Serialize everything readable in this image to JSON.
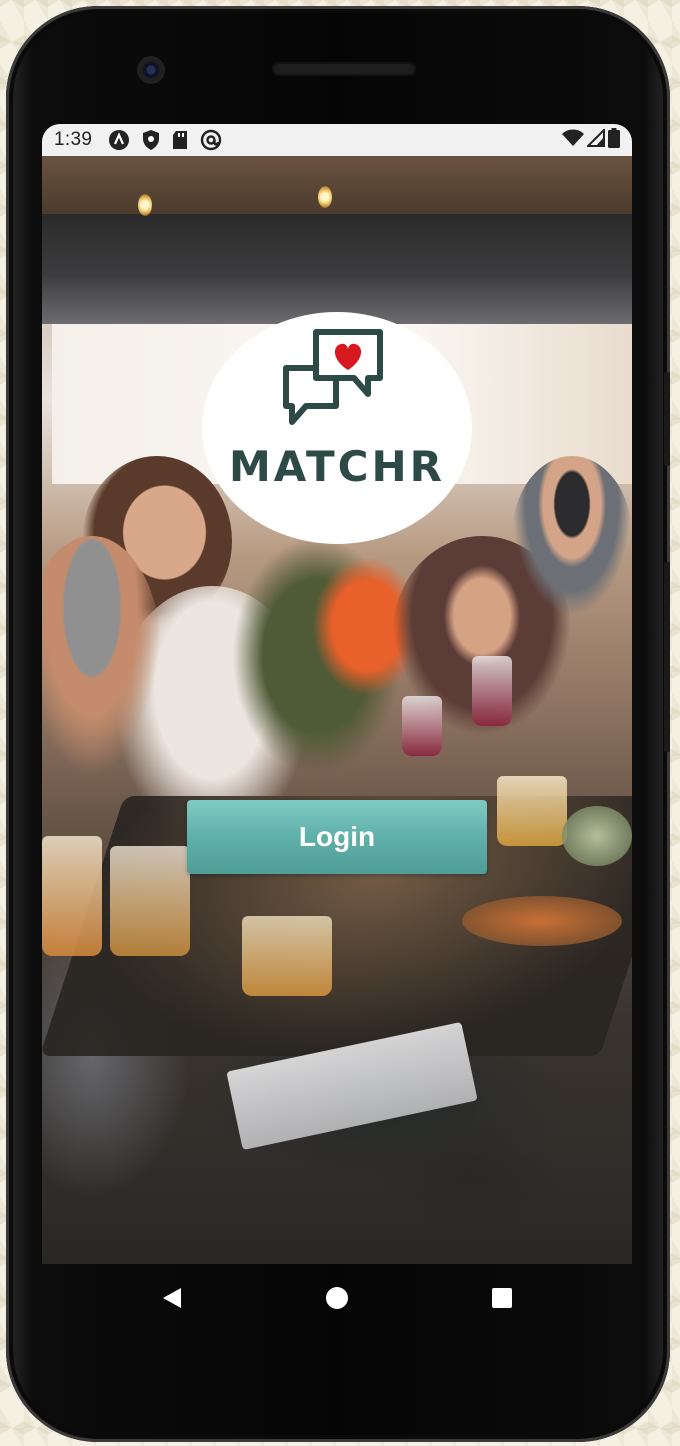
{
  "status_bar": {
    "time": "1:39",
    "left_icons": [
      "assistant-icon",
      "shield-icon",
      "sd-card-icon",
      "at-sign-icon"
    ],
    "right_icons": [
      "wifi-icon",
      "signal-icon",
      "battery-icon"
    ]
  },
  "logo": {
    "icon": "chat-bubbles-heart-icon",
    "text": "MATCHR",
    "text_color": "#2e4a46",
    "heart_color": "#d7191f"
  },
  "login_button": {
    "label": "Login",
    "color": "#5fb0a9"
  },
  "navigation": {
    "back_icon": "back-triangle-icon",
    "home_icon": "home-circle-icon",
    "recents_icon": "recents-square-icon"
  }
}
